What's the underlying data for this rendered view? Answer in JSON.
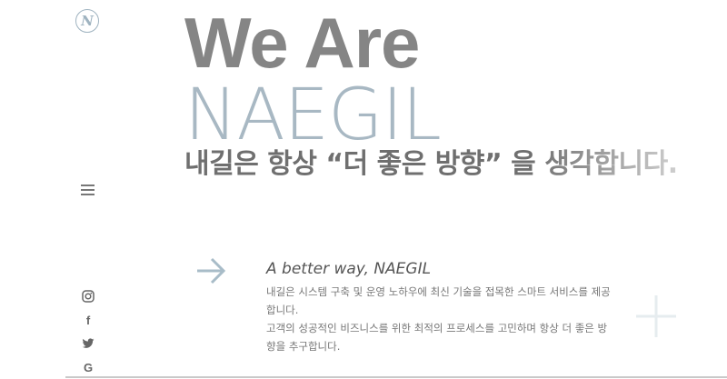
{
  "brand": {
    "logo_letter": "N"
  },
  "nav": {
    "menu_icon": "hamburger-icon"
  },
  "hero": {
    "line1": "We Are",
    "line2": "NAEGIL",
    "tagline": "내길은 항상 “더 좋은 방향” 을 생각합니다.",
    "colors": {
      "line1": "#858585",
      "line2": "#a8b8c3"
    }
  },
  "intro": {
    "arrow_icon": "arrow-right-icon",
    "subheading": "A better way, NAEGIL",
    "paragraph1": "내길은 시스템 구축 및 운영 노하우에 최신 기술을 접목한 스마트 서비스를 제공합니다.",
    "paragraph2": "고객의 성공적인 비즈니스를 위한 최적의 프로세스를 고민하며 항상 더 좋은 방향을 추구합니다."
  },
  "social": [
    {
      "name": "instagram",
      "icon": "instagram-icon"
    },
    {
      "name": "facebook",
      "icon": "facebook-icon",
      "glyph": "f"
    },
    {
      "name": "twitter",
      "icon": "twitter-icon"
    },
    {
      "name": "google",
      "icon": "google-icon",
      "glyph": "G"
    }
  ],
  "decor": {
    "plus_icon": "plus-icon"
  }
}
